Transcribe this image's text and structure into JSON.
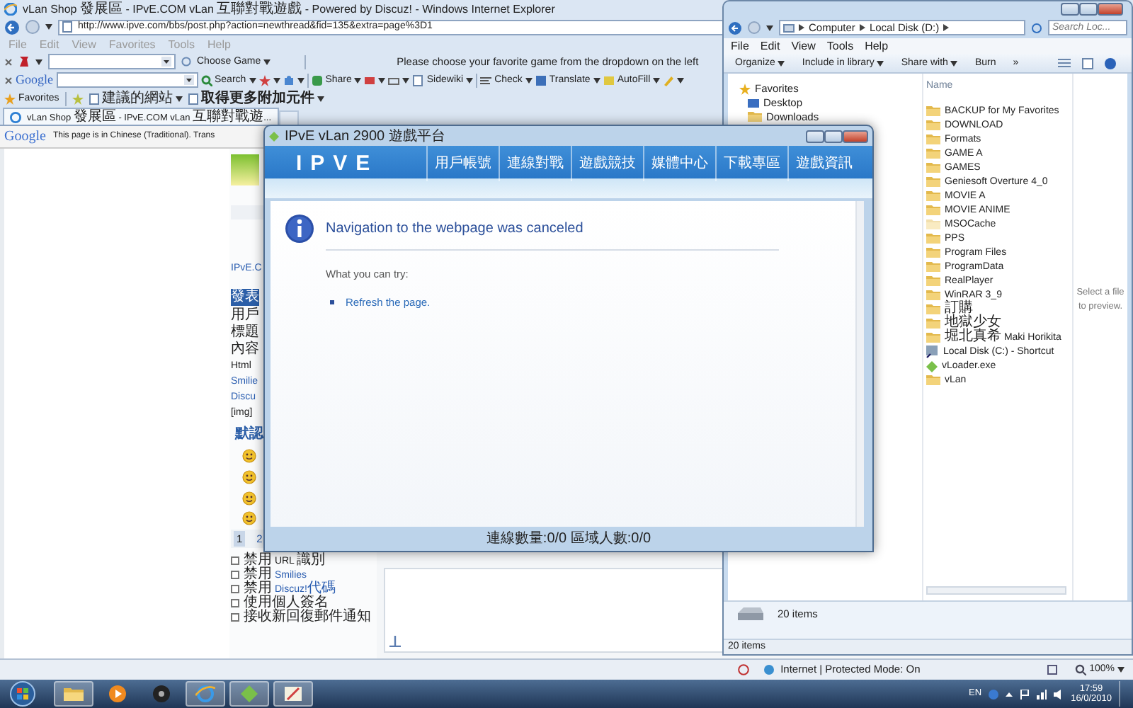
{
  "ie": {
    "title": "vLan Shop 發展區 - IPvE.COM vLan 互聯對戰遊戲 - Powered by Discuz! - Windows Internet Explorer",
    "address": "http://www.ipve.com/bbs/post.php?action=newthread&fid=135&extra=page%3D1",
    "menu": [
      "File",
      "Edit",
      "View",
      "Favorites",
      "Tools",
      "Help"
    ],
    "game_toolbar": {
      "button": "Choose Game",
      "message": "Please choose your favorite game from the dropdown on the left"
    },
    "google_toolbar": {
      "logo": "Google",
      "buttons": [
        {
          "kind": "search",
          "label": "Search"
        },
        {
          "kind": "bookmark"
        },
        {
          "kind": "puzzle"
        },
        {
          "kind": "share",
          "label": "Share"
        },
        {
          "kind": "mail"
        },
        {
          "kind": "window"
        },
        {
          "kind": "sidewiki",
          "label": "Sidewiki"
        },
        {
          "kind": "check",
          "label": "Check"
        },
        {
          "kind": "translate",
          "label": "Translate"
        },
        {
          "kind": "autofill",
          "label": "AutoFill"
        },
        {
          "kind": "pencil"
        }
      ]
    },
    "favorites_bar": {
      "label": "Favorites",
      "links": [
        "建議的網站",
        "取得更多附加元件"
      ]
    },
    "tab": {
      "title": "vLan Shop 發展區 - IPvE.COM vLan 互聯對戰遊..."
    },
    "translate_bar": {
      "logo": "Google",
      "message": "This page is in Chinese (Traditional).  Trans"
    },
    "page": {
      "site_link": "IPvE.C",
      "form_tab": "發表",
      "lines": [
        {
          "kind": "label",
          "text": "用戶"
        },
        {
          "kind": "label",
          "text": "標題"
        },
        {
          "kind": "label",
          "text": "內容"
        },
        {
          "kind": "label",
          "text": "Html"
        },
        {
          "kind": "link",
          "text": "Smilie"
        },
        {
          "kind": "link",
          "text": "Discu"
        },
        {
          "kind": "label",
          "text": "[img]"
        }
      ],
      "smileys_heading": "默認",
      "pages": [
        {
          "label": "1",
          "selected": true
        },
        {
          "label": "2",
          "selected": false
        }
      ],
      "options": [
        {
          "label": "禁用 URL 識別",
          "checked": false
        },
        {
          "label": "禁用",
          "link": "Smilies",
          "checked": false
        },
        {
          "label": "禁用",
          "link": "Discuz!代碼",
          "checked": false
        },
        {
          "label": "使用個人簽名",
          "checked": false
        },
        {
          "label": "接收新回復郵件通知",
          "checked": false
        }
      ]
    },
    "status_bar": {
      "zone": "Internet | Protected Mode: On",
      "zoom": "100%"
    }
  },
  "dialog": {
    "title": "IPvE vLan 2900 遊戲平台",
    "logo": "IPVE",
    "nav": [
      "用戶帳號",
      "連線對戰",
      "遊戲競技",
      "媒體中心",
      "下載專區",
      "遊戲資訊"
    ],
    "heading": "Navigation to the webpage was canceled",
    "prompt": "What you can try:",
    "actions": [
      "Refresh the page."
    ],
    "footer": "連線數量:0/0   區域人數:0/0"
  },
  "explorer": {
    "breadcrumb": [
      "Computer",
      "Local Disk (D:)"
    ],
    "search_placeholder": "Search Loc...",
    "menu": [
      "File",
      "Edit",
      "View",
      "Tools",
      "Help"
    ],
    "commands": [
      {
        "label": "Organize",
        "dropdown": true
      },
      {
        "label": "Include in library",
        "dropdown": true
      },
      {
        "label": "Share with",
        "dropdown": true
      },
      {
        "label": "Burn",
        "dropdown": false
      },
      {
        "label": "»",
        "dropdown": false
      }
    ],
    "nav": [
      {
        "kind": "favorites",
        "label": "Favorites"
      },
      {
        "kind": "desktop",
        "label": "Desktop"
      },
      {
        "kind": "folder",
        "label": "Downloads"
      }
    ],
    "column": "Name",
    "files": [
      {
        "kind": "folder",
        "name": "BACKUP for My Favorites",
        "hidden": false
      },
      {
        "kind": "folder",
        "name": "DOWNLOAD",
        "hidden": false
      },
      {
        "kind": "folder",
        "name": "Formats",
        "hidden": false
      },
      {
        "kind": "folder",
        "name": "GAME A",
        "hidden": false
      },
      {
        "kind": "folder",
        "name": "GAMES",
        "hidden": false
      },
      {
        "kind": "folder",
        "name": "Geniesoft Overture 4_0",
        "hidden": false
      },
      {
        "kind": "folder",
        "name": "MOVIE A",
        "hidden": false
      },
      {
        "kind": "folder",
        "name": "MOVIE ANIME",
        "hidden": false
      },
      {
        "kind": "folder",
        "name": "MSOCache",
        "hidden": true
      },
      {
        "kind": "folder",
        "name": "PPS",
        "hidden": false
      },
      {
        "kind": "folder",
        "name": "Program Files",
        "hidden": false
      },
      {
        "kind": "folder",
        "name": "ProgramData",
        "hidden": false
      },
      {
        "kind": "folder",
        "name": "RealPlayer",
        "hidden": false
      },
      {
        "kind": "folder",
        "name": "WinRAR 3_9",
        "hidden": false
      },
      {
        "kind": "folder",
        "name": "訂購",
        "hidden": false
      },
      {
        "kind": "folder",
        "name": "地獄少女",
        "hidden": false
      },
      {
        "kind": "folder",
        "name": "堀北真希 Maki Horikita",
        "hidden": false
      },
      {
        "kind": "shortcut",
        "name": "Local Disk (C:) - Shortcut",
        "hidden": false
      },
      {
        "kind": "exe",
        "name": "vLoader.exe",
        "hidden": false
      },
      {
        "kind": "folder",
        "name": "vLan",
        "hidden": false
      }
    ],
    "preview": "Select a file to preview.",
    "details": "20 items",
    "status": "20 items"
  },
  "taskbar": {
    "apps": [
      {
        "kind": "folder",
        "running": true
      },
      {
        "kind": "media",
        "running": false
      },
      {
        "kind": "disc",
        "running": false
      },
      {
        "kind": "browser",
        "running": true
      },
      {
        "kind": "vlan",
        "running": true
      },
      {
        "kind": "paint",
        "running": true
      }
    ],
    "language": "EN",
    "time": "17:59",
    "date": "16/0/2010"
  }
}
